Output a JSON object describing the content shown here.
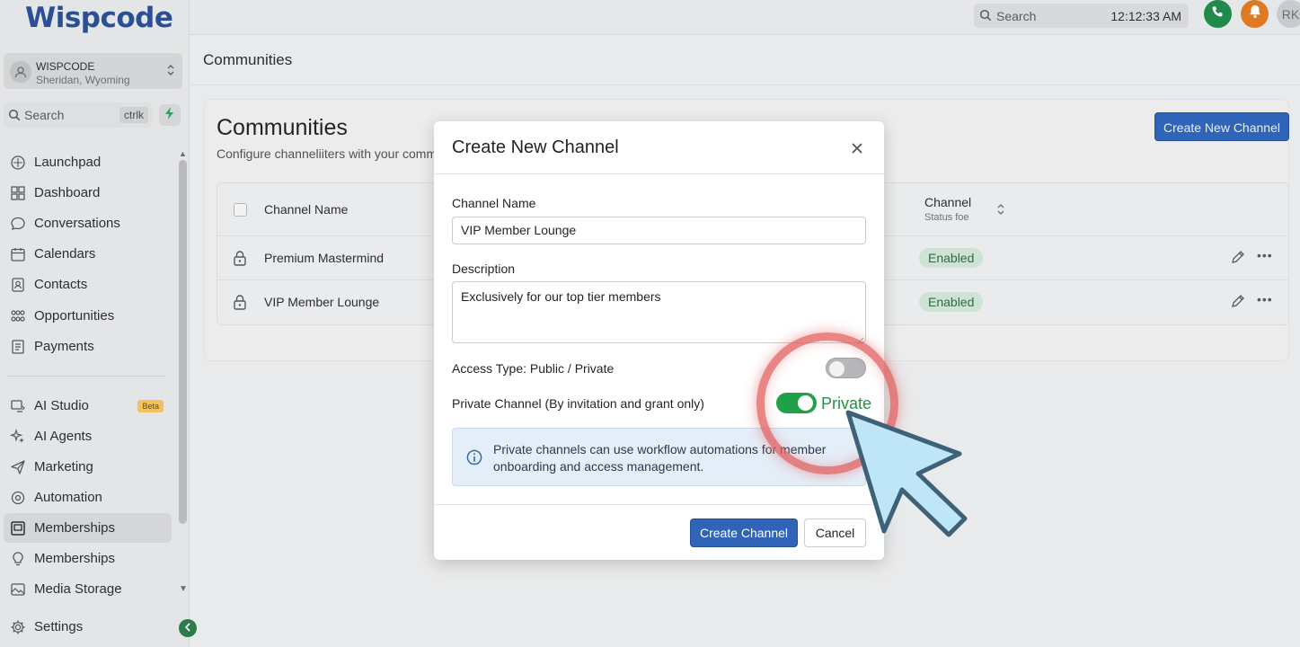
{
  "app": {
    "logo_text": "Wispcode",
    "brand_color": "#2a4f97"
  },
  "account": {
    "name": "WISPCODE",
    "location": "Sheridan, Wyoming"
  },
  "sidebar_search": {
    "placeholder": "Search",
    "shortcut": "ctrlk"
  },
  "sidebar": {
    "items": [
      {
        "label": "Launchpad",
        "icon": "launchpad-icon"
      },
      {
        "label": "Dashboard",
        "icon": "dashboard-icon"
      },
      {
        "label": "Conversations",
        "icon": "chat-icon"
      },
      {
        "label": "Calendars",
        "icon": "calendar-icon"
      },
      {
        "label": "Contacts",
        "icon": "contacts-icon"
      },
      {
        "label": "Opportunities",
        "icon": "opportunities-icon"
      },
      {
        "label": "Payments",
        "icon": "payments-icon"
      },
      {
        "label": "AI Studio",
        "icon": "ai-studio-icon",
        "badge": "Beta"
      },
      {
        "label": "AI Agents",
        "icon": "sparkle-icon"
      },
      {
        "label": "Marketing",
        "icon": "send-icon"
      },
      {
        "label": "Automation",
        "icon": "automation-icon"
      },
      {
        "label": "Memberships",
        "icon": "memberships-icon",
        "active": true
      },
      {
        "label": "Memberships",
        "icon": "lightbulb-icon"
      },
      {
        "label": "Media Storage",
        "icon": "media-icon"
      },
      {
        "label": "Settings",
        "icon": "gear-icon"
      }
    ]
  },
  "topbar": {
    "search_placeholder": "Search",
    "time": "12:12:33 AM",
    "user_initials": "RK"
  },
  "page": {
    "breadcrumb_title": "Communities",
    "card_title": "Communities",
    "card_subtitle": "Configure channeliiters with your comm",
    "create_button": "Create New Channel"
  },
  "table": {
    "columns": {
      "name": "Channel Name",
      "status": "Channel",
      "status_sub": "Status foe"
    },
    "rows": [
      {
        "name": "Premium Mastermind",
        "status": "Enabled"
      },
      {
        "name": "VIP Member Lounge",
        "status": "Enabled"
      }
    ]
  },
  "modal": {
    "title": "Create New Channel",
    "channel_name_label": "Channel Name",
    "channel_name_value": "VIP Member Lounge",
    "description_label": "Description",
    "description_value": "Exclusively for our top tier members",
    "access_type_label": "Access Type: Public / Private",
    "access_type_on": false,
    "private_label": "Private Channel (By invitation and grant only)",
    "private_on": true,
    "private_state_text": "Private",
    "info_text": "Private channels can use workflow automations for member onboarding and access management.",
    "create_button": "Create Channel",
    "cancel_button": "Cancel"
  },
  "colors": {
    "primary": "#2f64b8",
    "toggle_on": "#21a04a",
    "enabled_badge_bg": "#cfe3d4",
    "enabled_badge_text": "#2f6b40",
    "highlight_ring": "#e25c5c",
    "cursor_fill": "#bfe6f6"
  }
}
